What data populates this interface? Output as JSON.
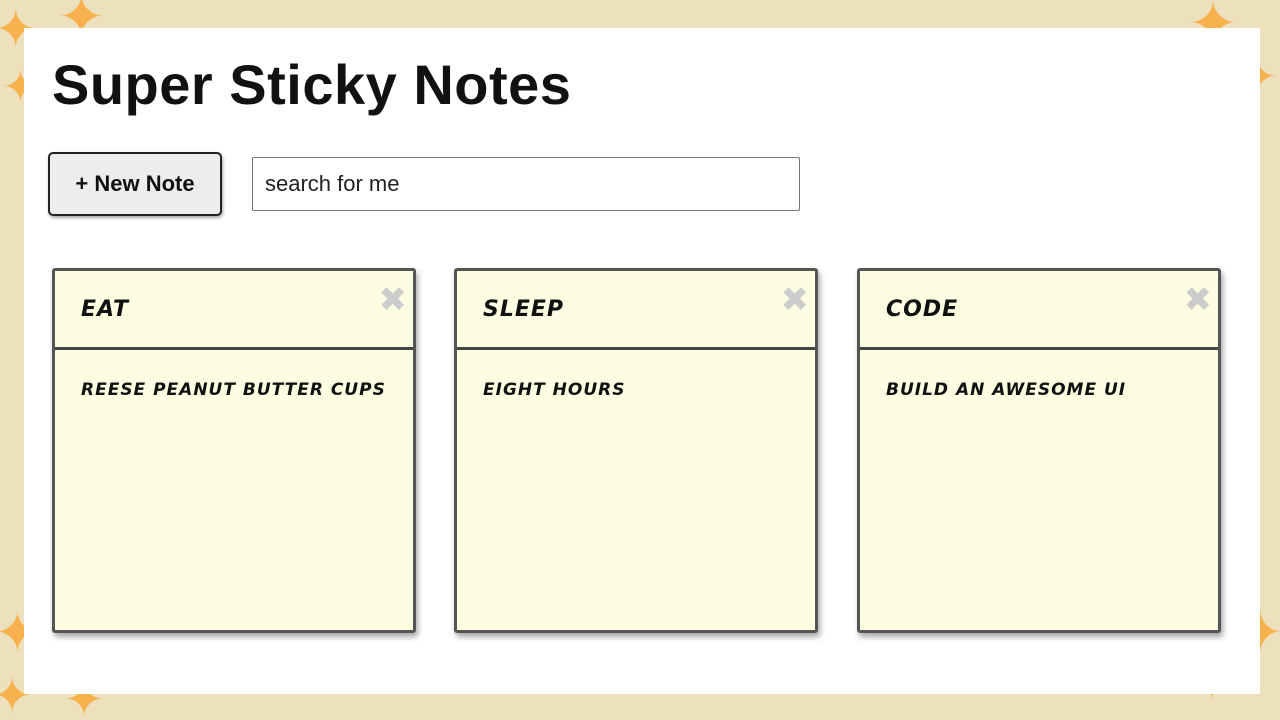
{
  "app": {
    "title": "Super Sticky Notes"
  },
  "toolbar": {
    "new_note_label": "+ New Note",
    "search_value": "search for me"
  },
  "notes": [
    {
      "title": "EAT",
      "body": "REESE PEANUT BUTTER CUPS",
      "close_glyph": "✖"
    },
    {
      "title": "SLEEP",
      "body": "EIGHT HOURS",
      "close_glyph": "✖"
    },
    {
      "title": "CODE",
      "body": "BUILD AN AWESOME UI",
      "close_glyph": "✖"
    }
  ],
  "decoration": {
    "sparkle_glyph": "✦",
    "sparkle_color": "#f7b24d",
    "frame_color": "#ece0bd",
    "note_color": "#fdfde2"
  }
}
